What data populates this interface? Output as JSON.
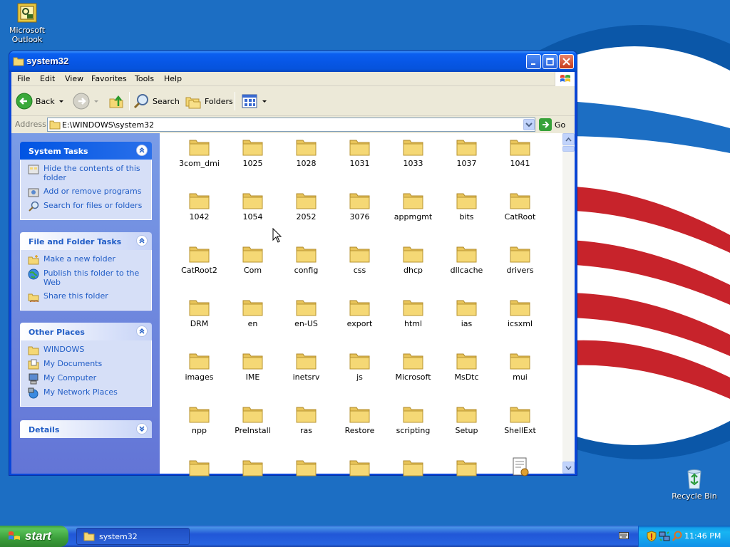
{
  "desktop": {
    "icons": [
      {
        "label": "Microsoft Outlook",
        "icon": "outlook-icon"
      },
      {
        "label": "Recycle Bin",
        "icon": "recycle-bin-icon"
      }
    ]
  },
  "window": {
    "title": "system32",
    "menu": [
      "File",
      "Edit",
      "View",
      "Favorites",
      "Tools",
      "Help"
    ],
    "toolbar": {
      "back_label": "Back",
      "search_label": "Search",
      "folders_label": "Folders"
    },
    "address": {
      "label": "Address",
      "value": "E:\\WINDOWS\\system32",
      "go_label": "Go"
    }
  },
  "left_pane": {
    "system_tasks": {
      "title": "System Tasks",
      "items": [
        "Hide the contents of this folder",
        "Add or remove programs",
        "Search for files or folders"
      ]
    },
    "file_folder_tasks": {
      "title": "File and Folder Tasks",
      "items": [
        "Make a new folder",
        "Publish this folder to the Web",
        "Share this folder"
      ]
    },
    "other_places": {
      "title": "Other Places",
      "items": [
        "WINDOWS",
        "My Documents",
        "My Computer",
        "My Network Places"
      ]
    },
    "details": {
      "title": "Details"
    }
  },
  "files": [
    "3com_dmi",
    "1025",
    "1028",
    "1031",
    "1033",
    "1037",
    "1041",
    "1042",
    "1054",
    "2052",
    "3076",
    "appmgmt",
    "bits",
    "CatRoot",
    "CatRoot2",
    "Com",
    "config",
    "css",
    "dhcp",
    "dllcache",
    "drivers",
    "DRM",
    "en",
    "en-US",
    "export",
    "html",
    "ias",
    "icsxml",
    "images",
    "IME",
    "inetsrv",
    "js",
    "Microsoft",
    "MsDtc",
    "mui",
    "npp",
    "PreInstall",
    "ras",
    "Restore",
    "scripting",
    "Setup",
    "ShellExt"
  ],
  "taskbar": {
    "start_label": "start",
    "task_label": "system32",
    "clock": "11:46 PM"
  },
  "colors": {
    "desktop": "#1c6ec3",
    "title_bar": "#0a5ff0",
    "task_link": "#215dc6",
    "folder": "#f5d875"
  }
}
